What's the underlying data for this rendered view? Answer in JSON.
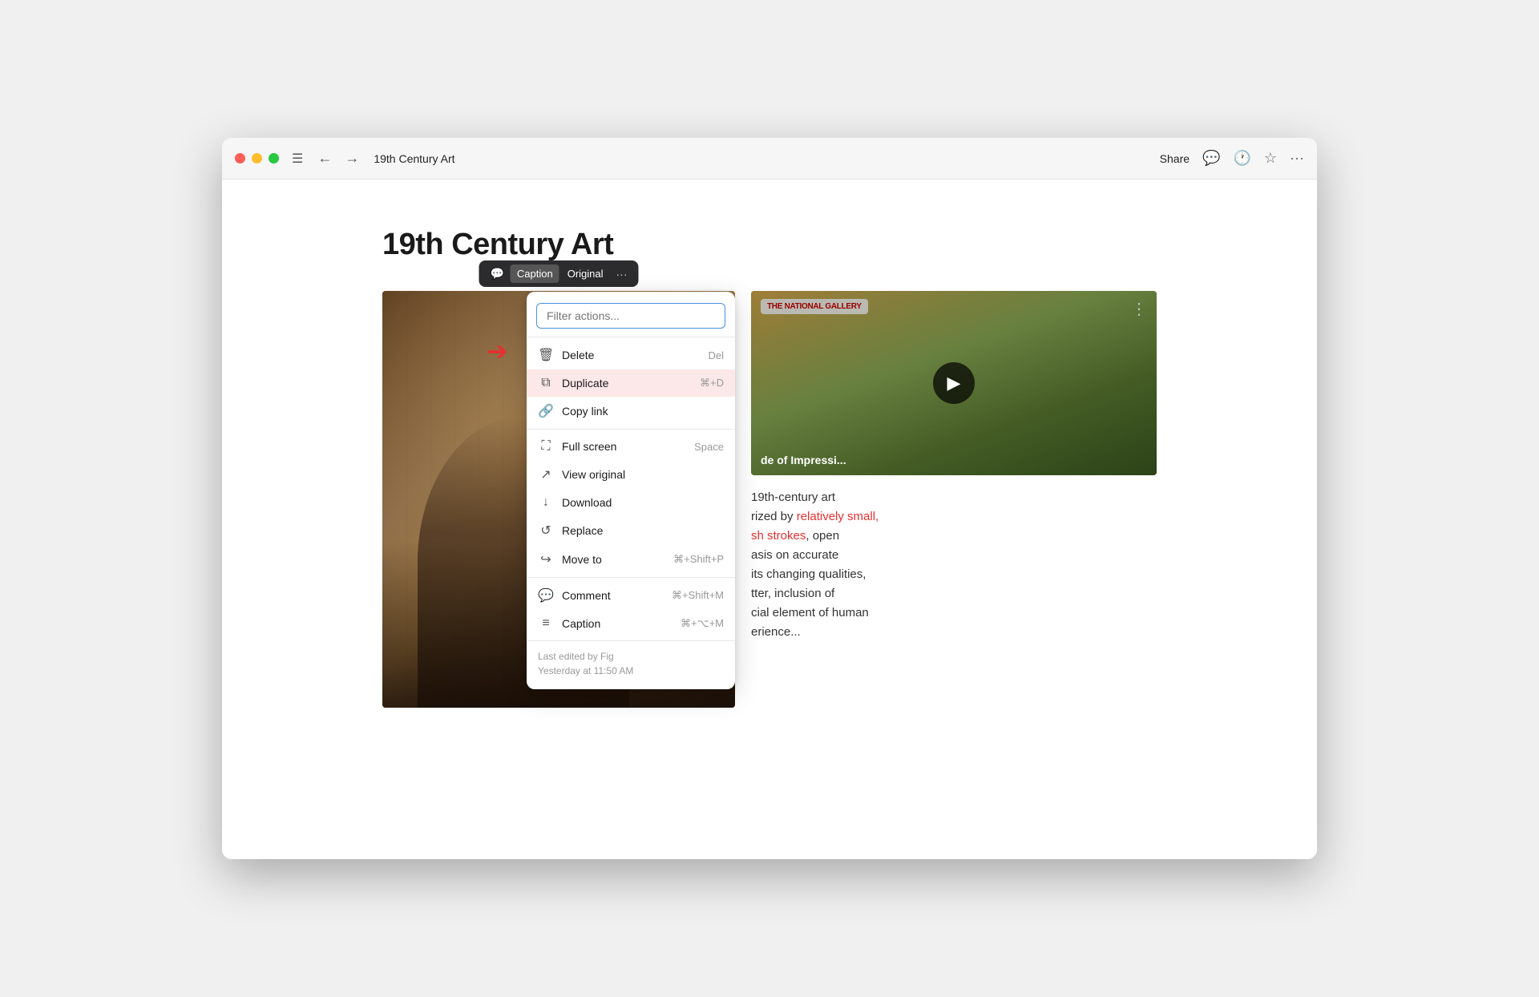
{
  "window": {
    "title": "19th Century Art"
  },
  "titlebar": {
    "nav_back": "←",
    "nav_forward": "→",
    "page_title": "19th Century Art",
    "share_label": "Share",
    "icons": {
      "chat": "💬",
      "clock": "🕐",
      "star": "☆",
      "more": "···"
    }
  },
  "page": {
    "heading": "19th Century Art"
  },
  "image_toolbar": {
    "caption_label": "Caption",
    "original_label": "Original",
    "more_icon": "···"
  },
  "video": {
    "channel": "THE NATIONAL GALLERY",
    "title": "de of Impressi...",
    "menu_icon": "⋮"
  },
  "text_block": {
    "before_red1": "19th-century art",
    "before_red2": "rized by ",
    "red_text1": "relatively small,",
    "after_red1": "",
    "red_text2": "sh strokes",
    "after_red2": ", open",
    "line3": "asis on accurate",
    "line4": "its changing qualities,",
    "line5": "tter, inclusion of",
    "line6": "cial element of human",
    "line7": "erience..."
  },
  "context_menu": {
    "filter_placeholder": "Filter actions...",
    "items": [
      {
        "icon": "🗑",
        "label": "Delete",
        "shortcut": "Del",
        "type": "delete"
      },
      {
        "icon": "⧉",
        "label": "Duplicate",
        "shortcut": "⌘+D",
        "type": "duplicate"
      },
      {
        "icon": "🔗",
        "label": "Copy link",
        "shortcut": "",
        "type": "copy-link"
      },
      {
        "icon": "⛶",
        "label": "Full screen",
        "shortcut": "Space",
        "type": "fullscreen"
      },
      {
        "icon": "↗",
        "label": "View original",
        "shortcut": "",
        "type": "view-original"
      },
      {
        "icon": "↓",
        "label": "Download",
        "shortcut": "",
        "type": "download"
      },
      {
        "icon": "↺",
        "label": "Replace",
        "shortcut": "",
        "type": "replace"
      },
      {
        "icon": "↪",
        "label": "Move to",
        "shortcut": "⌘+Shift+P",
        "type": "move-to"
      },
      {
        "icon": "💬",
        "label": "Comment",
        "shortcut": "⌘+Shift+M",
        "type": "comment"
      },
      {
        "icon": "≡",
        "label": "Caption",
        "shortcut": "⌘+⌥+M",
        "type": "caption"
      }
    ],
    "footer": {
      "edited_by": "Last edited by Fig",
      "time": "Yesterday at 11:50 AM"
    }
  }
}
